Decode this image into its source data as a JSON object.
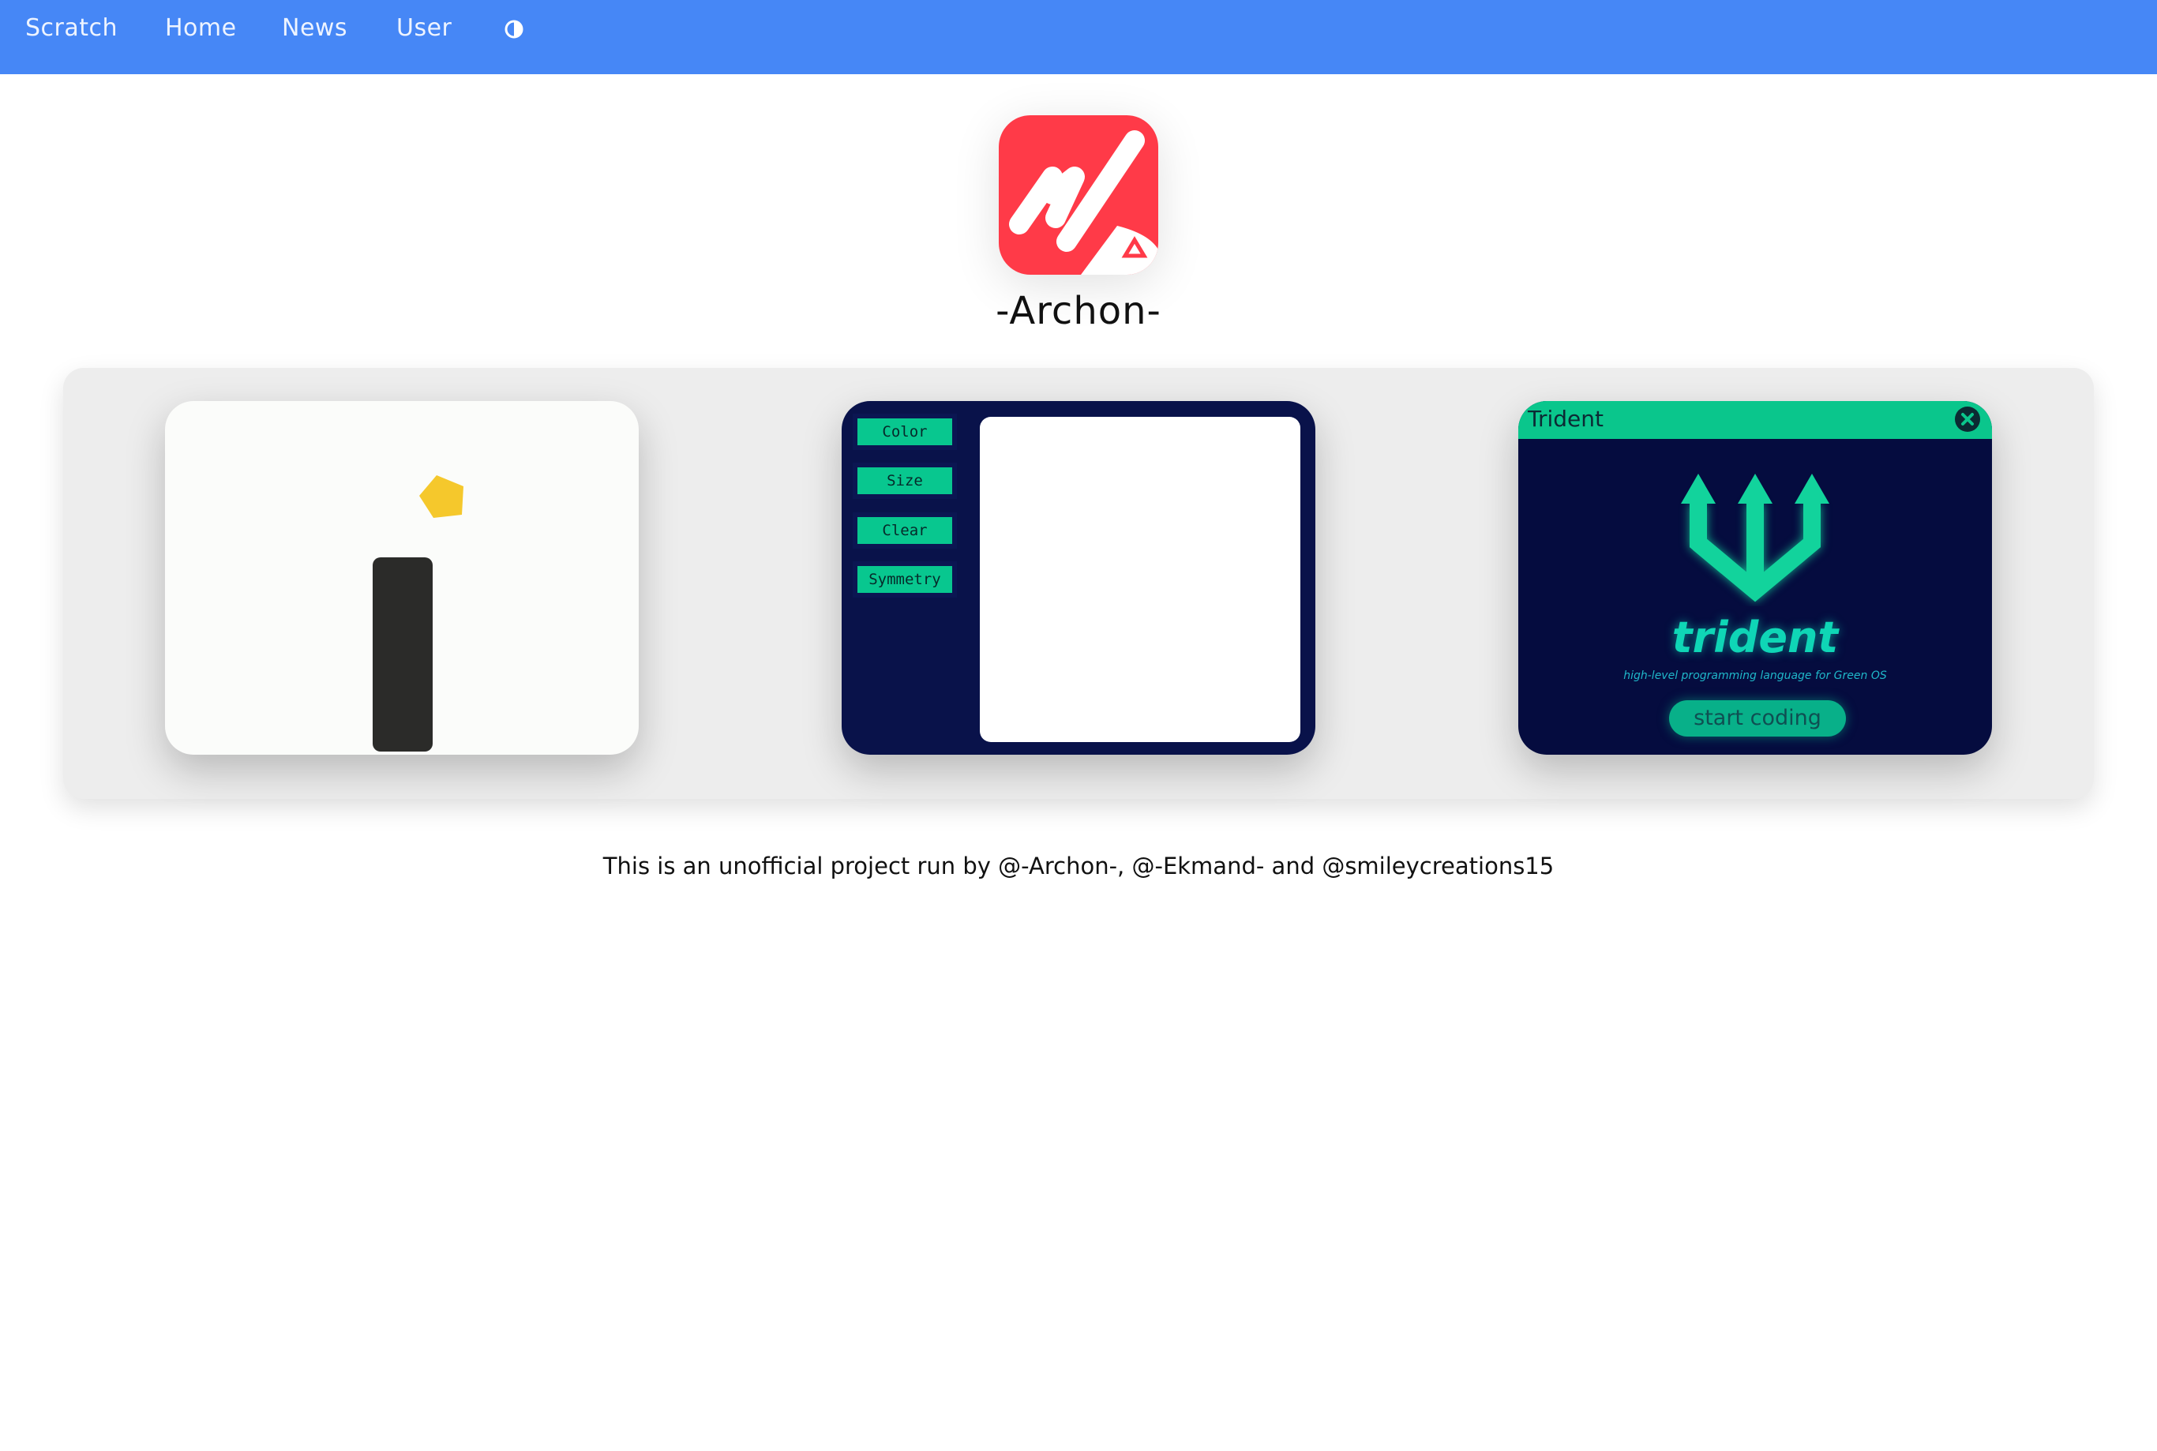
{
  "nav": {
    "items": [
      "Scratch",
      "Home",
      "News",
      "User"
    ],
    "theme_toggle_icon": "contrast-icon"
  },
  "brand": {
    "logo_icon": "archon-logo",
    "title": "-Archon-",
    "logo_color": "#ff3a48"
  },
  "gallery": {
    "cards": [
      {
        "kind": "game-preview",
        "background": "#fbfcfa",
        "shapes": [
          "yellow-pentagon",
          "dark-bar"
        ]
      },
      {
        "kind": "paint-app",
        "buttons": [
          "Color",
          "Size",
          "Clear",
          "Symmetry"
        ]
      },
      {
        "kind": "trident-app",
        "window_title": "Trident",
        "name": "trident",
        "subtitle": "high-level programming language for Green OS",
        "cta": "start coding",
        "logo_icon": "trident-icon",
        "close_icon": "close-icon"
      }
    ]
  },
  "footer": {
    "text": "This is an unofficial project run by @-Archon-, @-Ekmand- and @smileycreations15"
  },
  "colors": {
    "navbar": "#4687f6",
    "accent_green": "#08c78f",
    "dark_navy": "#050c3f"
  }
}
